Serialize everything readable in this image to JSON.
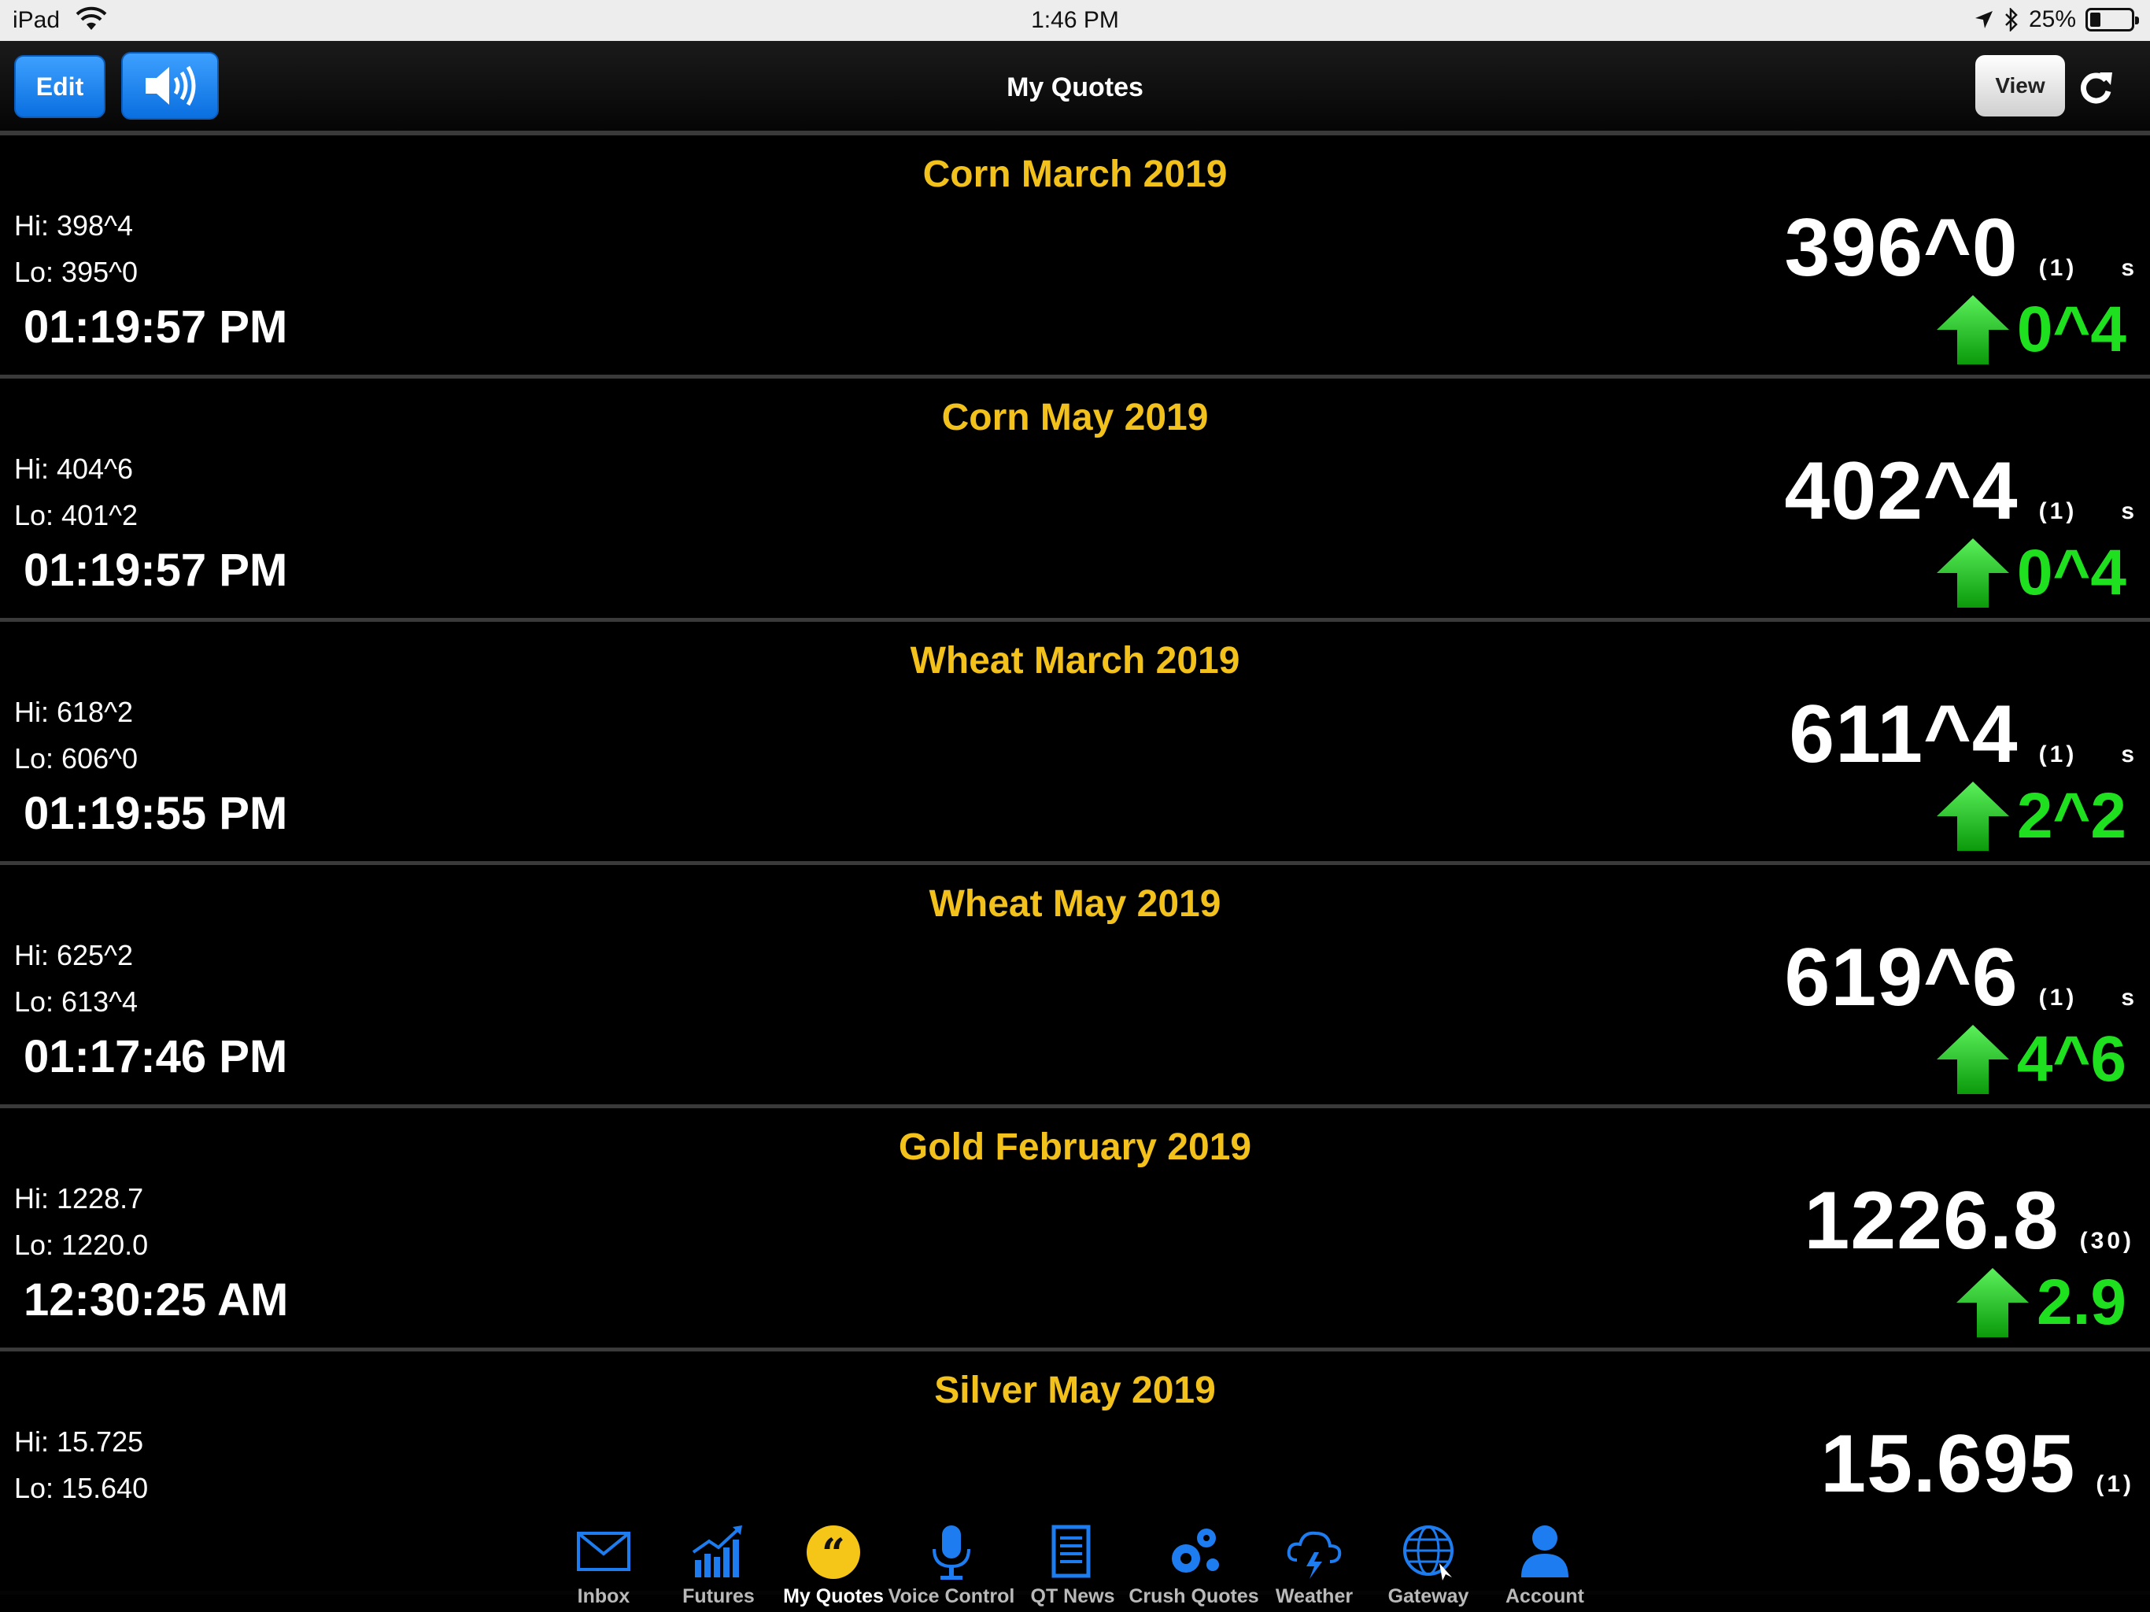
{
  "status_bar": {
    "device": "iPad",
    "time": "1:46 PM",
    "battery": "25%",
    "battery_level": 0.25
  },
  "nav": {
    "title": "My Quotes",
    "edit_label": "Edit",
    "view_label": "View"
  },
  "quotes": [
    {
      "title": "Corn March 2019",
      "hi": "Hi: 398^4",
      "lo": "Lo: 395^0",
      "time": "01:19:57 PM",
      "price": "396^0",
      "count": "(1)",
      "flag": "s",
      "change": "0^4",
      "direction": "up"
    },
    {
      "title": "Corn May 2019",
      "hi": "Hi: 404^6",
      "lo": "Lo: 401^2",
      "time": "01:19:57 PM",
      "price": "402^4",
      "count": "(1)",
      "flag": "s",
      "change": "0^4",
      "direction": "up"
    },
    {
      "title": "Wheat March 2019",
      "hi": "Hi: 618^2",
      "lo": "Lo: 606^0",
      "time": "01:19:55 PM",
      "price": "611^4",
      "count": "(1)",
      "flag": "s",
      "change": "2^2",
      "direction": "up"
    },
    {
      "title": "Wheat May 2019",
      "hi": "Hi: 625^2",
      "lo": "Lo: 613^4",
      "time": "01:17:46 PM",
      "price": "619^6",
      "count": "(1)",
      "flag": "s",
      "change": "4^6",
      "direction": "up"
    },
    {
      "title": "Gold February 2019",
      "hi": "Hi: 1228.7",
      "lo": "Lo: 1220.0",
      "time": "12:30:25 AM",
      "price": "1226.8",
      "count": "(30)",
      "flag": "",
      "change": "2.9",
      "direction": "up"
    },
    {
      "title": "Silver May 2019",
      "hi": "Hi: 15.725",
      "lo": "Lo: 15.640",
      "time": "",
      "price": "15.695",
      "count": "(1)",
      "flag": "",
      "change": "",
      "direction": ""
    }
  ],
  "tabs": [
    {
      "label": "Inbox",
      "icon": "envelope-icon"
    },
    {
      "label": "Futures",
      "icon": "chart-icon"
    },
    {
      "label": "My Quotes",
      "icon": "quote-icon",
      "active": true
    },
    {
      "label": "Voice Control",
      "icon": "microphone-icon"
    },
    {
      "label": "QT News",
      "icon": "news-icon"
    },
    {
      "label": "Crush Quotes",
      "icon": "gears-icon"
    },
    {
      "label": "Weather",
      "icon": "storm-cloud-icon"
    },
    {
      "label": "Gateway",
      "icon": "globe-icon"
    },
    {
      "label": "Account",
      "icon": "person-icon"
    }
  ],
  "colors": {
    "title_gold": "#f2c11b",
    "change_green": "#1fe01f",
    "tab_blue": "#1d7df0",
    "active_yellow": "#f5c518"
  }
}
